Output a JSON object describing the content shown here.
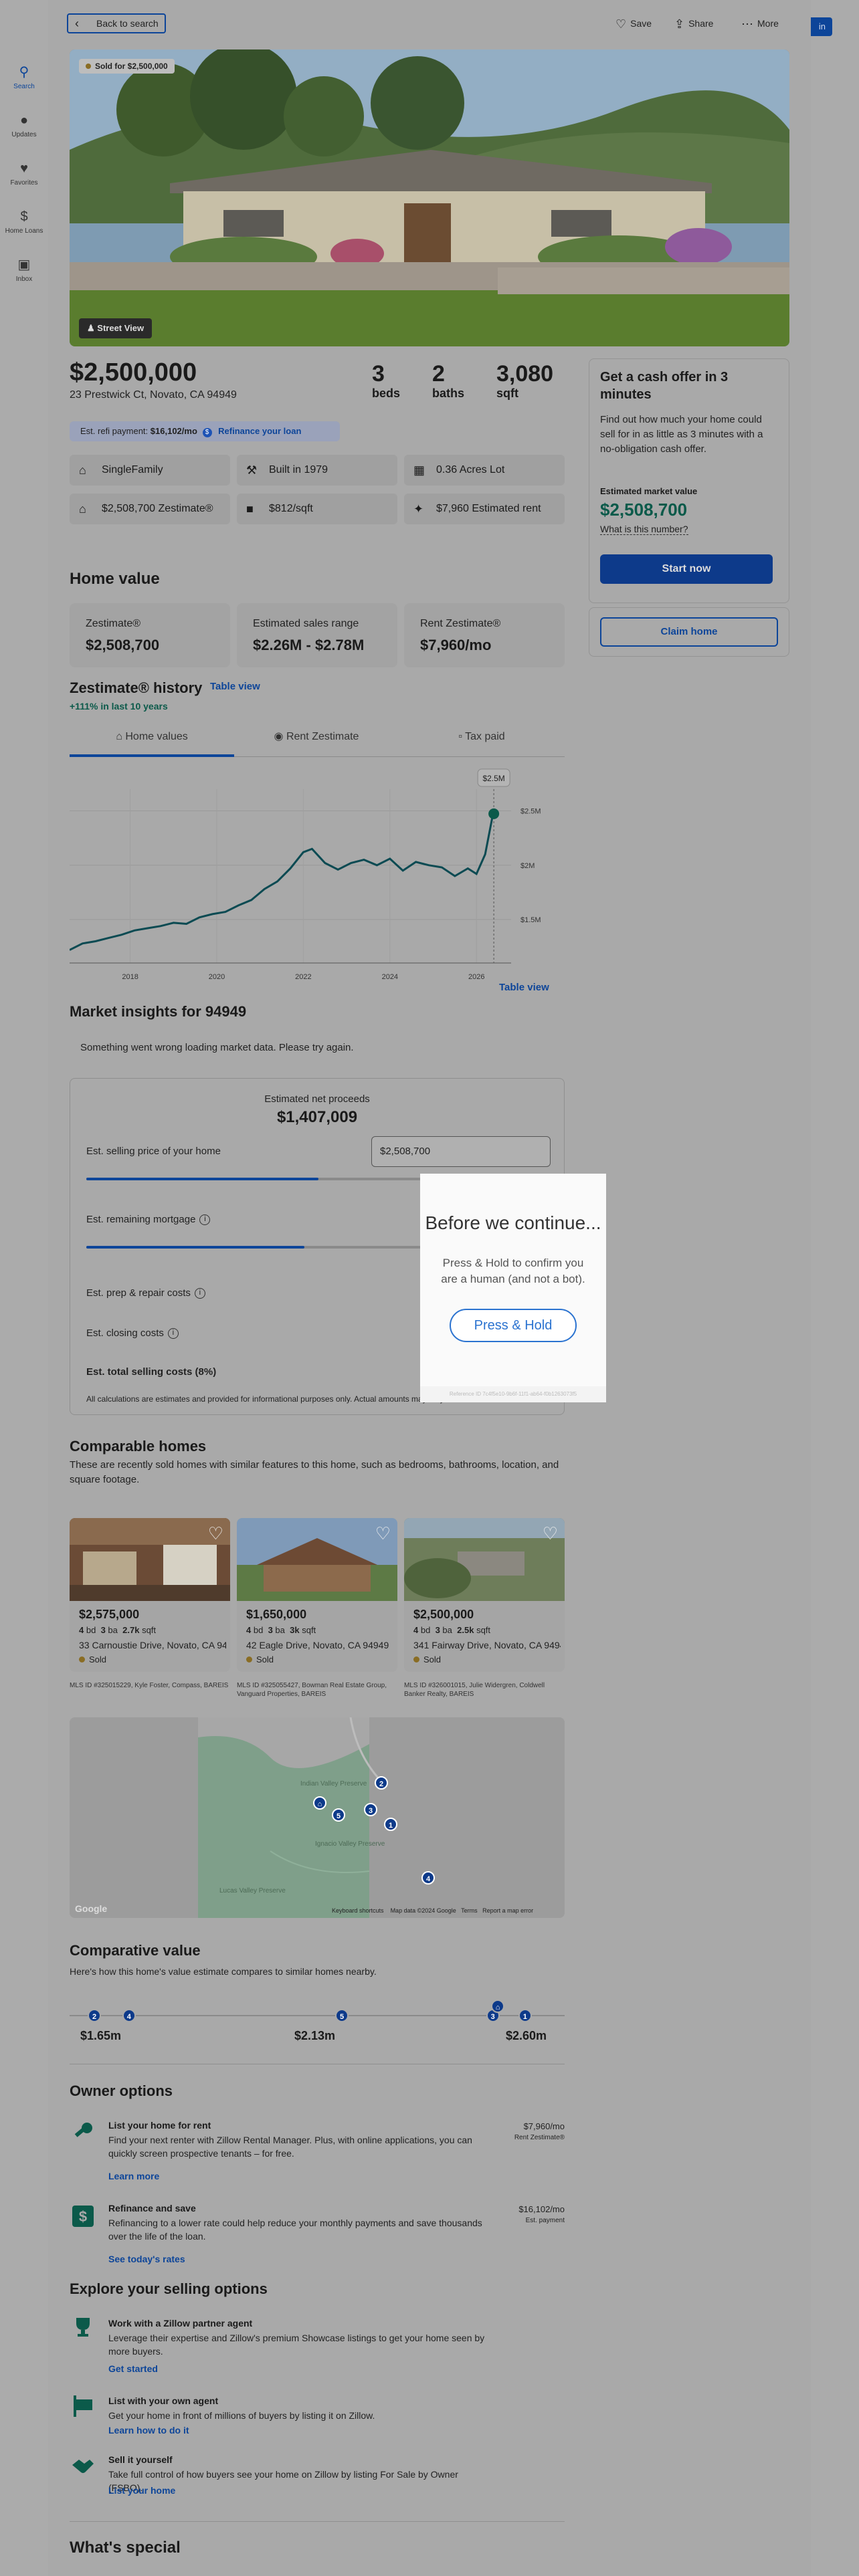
{
  "nav": {
    "back": "Back to search",
    "save": "Save",
    "share": "Share",
    "more": "More",
    "signin": "in"
  },
  "sidebar": {
    "items": [
      {
        "label": "Search",
        "icon": "search-icon"
      },
      {
        "label": "Updates",
        "icon": "bell-icon"
      },
      {
        "label": "Favorites",
        "icon": "heart-icon"
      },
      {
        "label": "Home Loans",
        "icon": "dollar-icon"
      },
      {
        "label": "Inbox",
        "icon": "inbox-icon"
      }
    ]
  },
  "hero": {
    "sold_badge": "Sold for $2,500,000",
    "street_view": "Street View"
  },
  "summary": {
    "price": "$2,500,000",
    "address": "23 Prestwick Ct, Novato, CA 94949",
    "beds_n": "3",
    "beds_u": "beds",
    "baths_n": "2",
    "baths_u": "baths",
    "sqft_n": "3,080",
    "sqft_u": "sqft",
    "refi_label": "Est. refi payment:",
    "refi_value": "$16,102/mo",
    "refi_link": "Refinance your loan"
  },
  "facts": [
    {
      "icon": "house-icon",
      "text": "SingleFamily"
    },
    {
      "icon": "hammer-icon",
      "text": "Built in 1979"
    },
    {
      "icon": "lot-icon",
      "text": "0.36 Acres Lot"
    },
    {
      "icon": "zestimate-icon",
      "text": "$2,508,700 Zestimate®"
    },
    {
      "icon": "ruler-icon",
      "text": "$812/sqft"
    },
    {
      "icon": "rent-icon",
      "text": "$7,960 Estimated rent"
    }
  ],
  "home_value": {
    "title": "Home value",
    "cards": [
      {
        "label": "Zestimate®",
        "value": "$2,508,700"
      },
      {
        "label": "Estimated sales range",
        "value": "$2.26M - $2.78M"
      },
      {
        "label": "Rent Zestimate®",
        "value": "$7,960/mo"
      }
    ],
    "history_title": "Zestimate® history",
    "table_view": "Table view",
    "growth": "+111% in last 10 years",
    "tabs": [
      "Home values",
      "Rent Zestimate",
      "Tax paid"
    ],
    "table_view_bottom": "Table view",
    "tooltip": "$2.5M"
  },
  "chart_data": {
    "type": "line",
    "x": [
      2016.6,
      2016.9,
      2017.2,
      2017.5,
      2017.8,
      2018.1,
      2018.4,
      2018.7,
      2019.0,
      2019.3,
      2019.6,
      2019.9,
      2020.2,
      2020.5,
      2020.8,
      2021.1,
      2021.4,
      2021.7,
      2022.0,
      2022.2,
      2022.5,
      2022.8,
      2023.1,
      2023.4,
      2023.7,
      2024.0,
      2024.3,
      2024.6,
      2024.9,
      2025.2,
      2025.5,
      2025.8,
      2026.0,
      2026.2,
      2026.4
    ],
    "values": [
      1.22,
      1.28,
      1.3,
      1.33,
      1.36,
      1.4,
      1.42,
      1.44,
      1.47,
      1.46,
      1.52,
      1.55,
      1.57,
      1.63,
      1.68,
      1.78,
      1.85,
      1.97,
      2.12,
      2.15,
      2.02,
      1.96,
      2.02,
      2.05,
      2.0,
      2.06,
      1.95,
      2.03,
      2.0,
      1.98,
      1.9,
      1.97,
      1.92,
      2.1,
      2.51
    ],
    "x_ticks": [
      "2018",
      "2020",
      "2022",
      "2024",
      "2026"
    ],
    "x_tick_values": [
      2018,
      2020,
      2022,
      2024,
      2026
    ],
    "y_ticks": [
      "$1.5M",
      "$2M",
      "$2.5M"
    ],
    "y_tick_values": [
      1.5,
      2.0,
      2.5
    ],
    "ylim": [
      1.1,
      2.7
    ],
    "xlim": [
      2016.6,
      2026.8
    ],
    "grid": true
  },
  "market": {
    "title": "Market insights for 94949",
    "error": "Something went wrong loading market data. Please try again.",
    "net_label": "Estimated net proceeds",
    "net_value": "$1,407,009",
    "sell_label": "Est. selling price of your home",
    "sell_value": "$2,508,700",
    "mortgage_label": "Est. remaining mortgage",
    "repair_label": "Est. prep & repair costs",
    "closing_label": "Est. closing costs",
    "total_label": "Est. total selling costs (8%)",
    "disclaimer": "All calculations are estimates and provided for informational purposes only. Actual amounts may vary.",
    "sell_slider": 0.5,
    "mortgage_slider": 0.47
  },
  "modal": {
    "title": "Before we continue...",
    "body": "Press & Hold to confirm you are a human (and not a bot).",
    "button": "Press & Hold",
    "reference": "Reference ID 7c4f5e10-9b6f-11f1-ab64-f0b1263073f5"
  },
  "comparables": {
    "title": "Comparable homes",
    "description": "These are recently sold homes with similar features to this home, such as bedrooms, bathrooms, location, and square footage.",
    "homes": [
      {
        "price": "$2,575,000",
        "bd": "4",
        "ba": "3",
        "sqft": "2.7k",
        "address": "33 Carnoustie Drive, Novato, CA 94949",
        "status": "Sold",
        "mls": "MLS ID #325015229, Kyle Foster, Compass, BAREIS"
      },
      {
        "price": "$1,650,000",
        "bd": "4",
        "ba": "3",
        "sqft": "3k",
        "address": "42 Eagle Drive, Novato, CA 94949",
        "status": "Sold",
        "mls": "MLS ID #325055427, Bowman Real Estate Group, Vanguard Properties, BAREIS"
      },
      {
        "price": "$2,500,000",
        "bd": "4",
        "ba": "3",
        "sqft": "2.5k",
        "address": "341 Fairway Drive, Novato, CA 94949",
        "status": "Sold",
        "mls": "MLS ID #326001015, Julie Widergren, Coldwell Banker Realty, BAREIS"
      }
    ],
    "units": {
      "bd": "bd",
      "ba": "ba",
      "sqft": "sqft"
    }
  },
  "map": {
    "labels": [
      "Indian Valley Preserve",
      "Ignacio Valley Preserve",
      "Lucas Valley Preserve"
    ],
    "attribution": [
      "Keyboard shortcuts",
      "Map data ©2024 Google",
      "Terms",
      "Report a map error"
    ],
    "google": "Google"
  },
  "comparative": {
    "title": "Comparative value",
    "subtitle": "Here's how this home's value estimate compares to similar homes nearby.",
    "low": "$1.65m",
    "mid": "$2.13m",
    "high": "$2.60m",
    "pins": [
      {
        "label": "2",
        "pos": 0.05
      },
      {
        "label": "4",
        "pos": 0.12
      },
      {
        "label": "5",
        "pos": 0.55
      },
      {
        "label": "3",
        "pos": 0.855
      },
      {
        "label": "1",
        "pos": 0.92
      }
    ],
    "home_pos": 0.865
  },
  "owner": {
    "title": "Owner options",
    "options": [
      {
        "title": "List your home for rent",
        "body": "Find your next renter with Zillow Rental Manager. Plus, with online applications, you can quickly screen prospective tenants – for free.",
        "link": "Learn more",
        "right": "$7,960/mo",
        "right_sub": "Rent Zestimate®"
      },
      {
        "title": "Refinance and save",
        "body": "Refinancing to a lower rate could help reduce your monthly payments and save thousands over the life of the loan.",
        "link": "See today's rates",
        "right": "$16,102/mo",
        "right_sub": "Est. payment"
      }
    ]
  },
  "explore": {
    "title": "Explore your selling options",
    "options": [
      {
        "title": "Work with a Zillow partner agent",
        "body": "Leverage their expertise and Zillow's premium Showcase listings to get your home seen by more buyers.",
        "link": "Get started"
      },
      {
        "title": "List with your own agent",
        "body": "Get your home in front of millions of buyers by listing it on Zillow.",
        "link": "Learn how to do it"
      },
      {
        "title": "Sell it yourself",
        "body": "Take full control of how buyers see your home on Zillow by listing For Sale by Owner (FSBO).",
        "link": "List your home"
      }
    ]
  },
  "special": {
    "title": "What's special"
  },
  "cash_offer": {
    "title": "Get a cash offer in 3 minutes",
    "body": "Find out how much your home could sell for in as little as 3 minutes with a no-obligation cash offer.",
    "est_label": "Estimated market value",
    "est_value": "$2,508,700",
    "what": "What is this number?",
    "start": "Start now",
    "claim": "Claim home"
  }
}
